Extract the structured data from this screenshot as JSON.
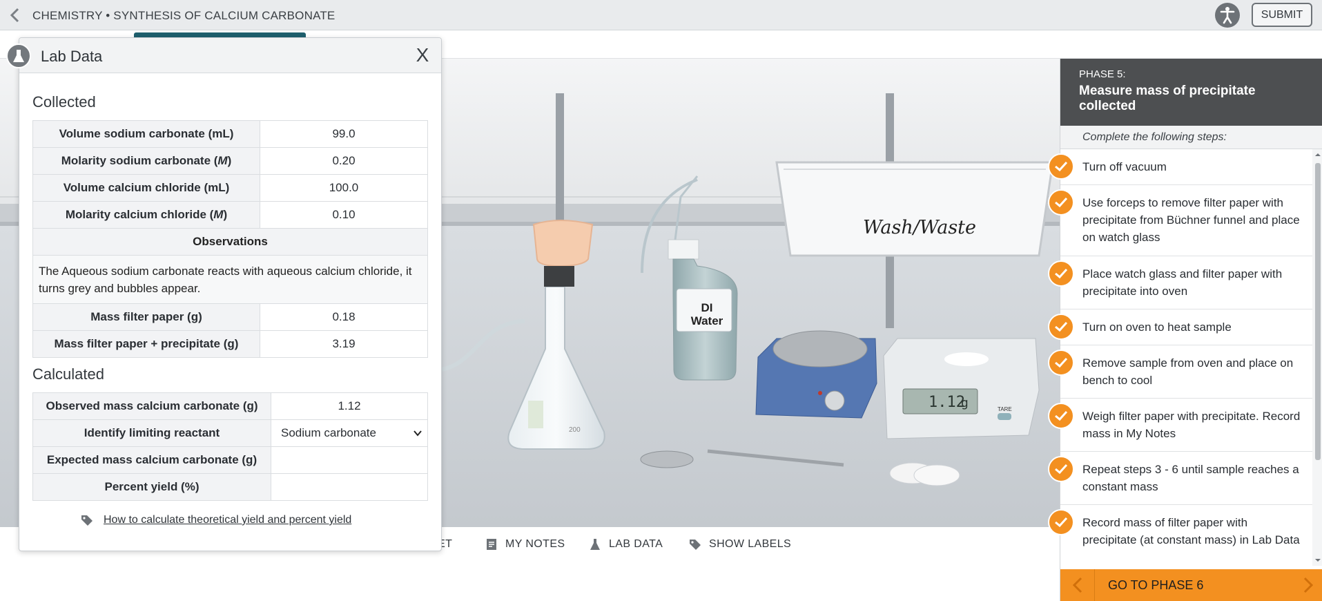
{
  "header": {
    "title": "CHEMISTRY • SYNTHESIS OF CALCIUM CARBONATE",
    "submit_label": "SUBMIT"
  },
  "scene": {
    "wash_label": "Wash/Waste",
    "bottle_label_line1": "DI",
    "bottle_label_line2": "Water",
    "scale_readout": "1.12",
    "scale_unit": "g",
    "tare_label": "TARE",
    "flask_mark": "200"
  },
  "toolbar": {
    "reset_label": "SET",
    "notes_label": "MY NOTES",
    "labdata_label": "LAB DATA",
    "labels_label": "SHOW LABELS"
  },
  "lab_data": {
    "title": "Lab Data",
    "close_label": "X",
    "collected_title": "Collected",
    "collected": [
      {
        "label": "Volume sodium carbonate (mL)",
        "value": "99.0"
      },
      {
        "label": "Molarity sodium carbonate (",
        "unit": "M",
        "label_end": ")",
        "value": "0.20"
      },
      {
        "label": "Volume calcium chloride (mL)",
        "value": "100.0"
      },
      {
        "label": "Molarity calcium chloride (",
        "unit": "M",
        "label_end": ")",
        "value": "0.10"
      }
    ],
    "observations_label": "Observations",
    "observations_text": "The Aqueous sodium carbonate reacts with aqueous calcium chloride, it turns grey and bubbles appear.",
    "mass_rows": [
      {
        "label": "Mass filter paper (g)",
        "value": "0.18"
      },
      {
        "label": "Mass filter paper + precipitate (g)",
        "value": "3.19"
      }
    ],
    "calculated_title": "Calculated",
    "calculated": [
      {
        "label": "Observed mass calcium carbonate (g)",
        "value": "1.12"
      },
      {
        "label": "Identify limiting reactant",
        "value": "Sodium carbonate"
      },
      {
        "label": "Expected mass calcium carbonate (g)",
        "value": ""
      },
      {
        "label": "Percent yield (%)",
        "value": ""
      }
    ],
    "help_link": "How to calculate theoretical yield and percent yield"
  },
  "phase": {
    "label": "PHASE 5:",
    "title": "Measure mass of precipitate collected",
    "subtitle": "Complete the following steps:",
    "steps": [
      "Turn off vacuum",
      "Use forceps to remove filter paper with precipitate from Büchner funnel and place on watch glass",
      "Place watch glass and filter paper with precipitate into oven",
      "Turn on oven to heat sample",
      "Remove sample from oven and place on bench to cool",
      "Weigh filter paper with precipitate. Record mass in My Notes",
      "Repeat steps 3 - 6 until sample reaches a constant mass",
      "Record mass of filter paper with precipitate (at constant mass) in Lab Data"
    ],
    "next_label": "GO TO PHASE 6"
  },
  "colors": {
    "accent_orange": "#f39020",
    "header_dark": "#4d4f51",
    "teal_tab": "#1e5f6d"
  }
}
